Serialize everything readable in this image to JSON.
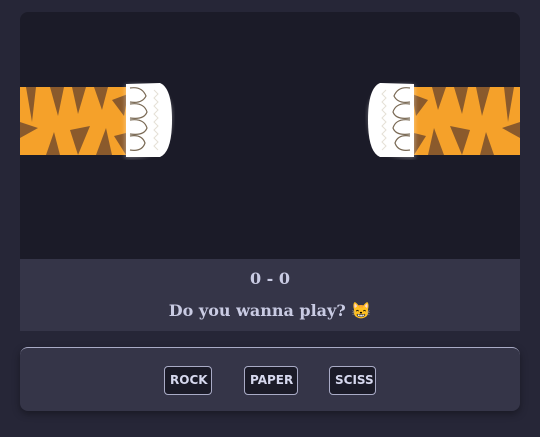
{
  "game": {
    "score": "0 - 0",
    "message": "Do you wanna play? 😸"
  },
  "controls": {
    "rock_label": "ROCK",
    "paper_label": "PAPER",
    "scissors_label": "SCISS"
  },
  "colors": {
    "background": "#262637",
    "arena": "#1b1b28",
    "panel": "#353548",
    "tiger_orange": "#f5a12a",
    "tiger_stripe": "#8a5a2c",
    "paw_white": "#ffffff",
    "text": "#c9cbe3"
  },
  "icons": [
    "tiger-paw-left-icon",
    "tiger-paw-right-icon"
  ]
}
